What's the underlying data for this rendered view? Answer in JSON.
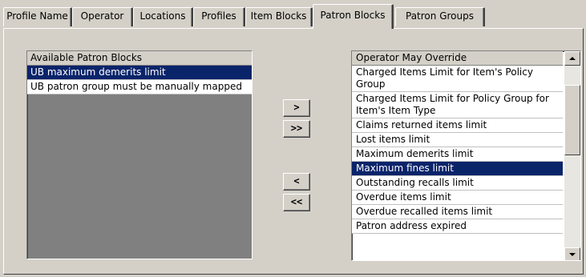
{
  "tabs": [
    {
      "label": "Profile Name",
      "active": false
    },
    {
      "label": "Operator",
      "active": false
    },
    {
      "label": "Locations",
      "active": false
    },
    {
      "label": "Profiles",
      "active": false
    },
    {
      "label": "Item Blocks",
      "active": false
    },
    {
      "label": "Patron Blocks",
      "active": true
    },
    {
      "label": "Patron Groups",
      "active": false
    }
  ],
  "available": {
    "header": "Available Patron Blocks",
    "items": [
      "UB maximum demerits limit",
      "UB patron group must be manually mapped"
    ],
    "selected_index": 0
  },
  "buttons": {
    "add": ">",
    "add_all": ">>",
    "remove": "<",
    "remove_all": "<<"
  },
  "override": {
    "header": "Operator May Override",
    "items": [
      "Charged Items Limit for Item's Policy Group",
      "Charged Items Limit for Policy Group for Item's Item Type",
      "Claims returned items limit",
      "Lost items limit",
      "Maximum demerits limit",
      "Maximum fines limit",
      "Outstanding recalls limit",
      "Overdue items limit",
      "Overdue recalled items limit",
      "Patron address expired"
    ],
    "selected_index": 5
  },
  "colors": {
    "selection": "#0a246a",
    "face": "#d4d0c8"
  },
  "icons": {
    "scroll_up": "up-triangle",
    "scroll_down": "down-triangle"
  }
}
